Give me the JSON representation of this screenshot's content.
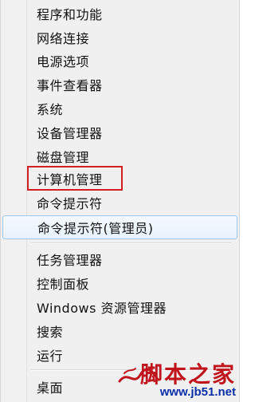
{
  "menu": {
    "items": [
      {
        "label": "程序和功能"
      },
      {
        "label": "网络连接"
      },
      {
        "label": "电源选项"
      },
      {
        "label": "事件查看器"
      },
      {
        "label": "系统"
      },
      {
        "label": "设备管理器"
      },
      {
        "label": "磁盘管理"
      },
      {
        "label": "计算机管理"
      },
      {
        "label": "命令提示符"
      },
      {
        "label": "命令提示符(管理员)"
      },
      {
        "label": "任务管理器"
      },
      {
        "label": "控制面板"
      },
      {
        "label": "Windows 资源管理器"
      },
      {
        "label": "搜索"
      },
      {
        "label": "运行"
      },
      {
        "label": "桌面"
      }
    ],
    "highlighted_item": "命令提示符(管理员)",
    "annotated_item": "计算机管理"
  },
  "watermark": {
    "title": "脚本之家",
    "url": "www.jb51.net"
  },
  "colors": {
    "menu_bg": "#f0f0f0",
    "highlight_border": "#9cc6ea",
    "annotation_red": "#d21f1f",
    "watermark_red": "#c0151d",
    "watermark_blue": "#0b2fa8"
  }
}
